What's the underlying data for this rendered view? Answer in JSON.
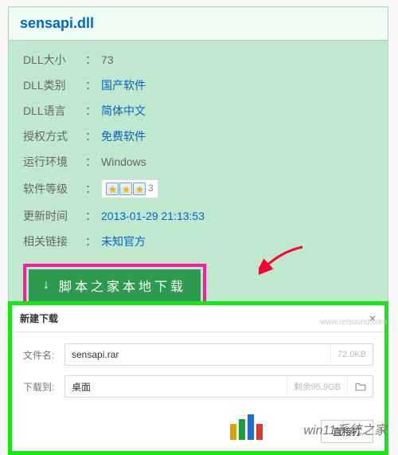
{
  "title": "sensapi.dll",
  "info": {
    "size_label": "DLL大小",
    "size_value": "73",
    "category_label": "DLL类别",
    "category_value": "国产软件",
    "language_label": "DLL语言",
    "language_value": "简体中文",
    "license_label": "授权方式",
    "license_value": "免费软件",
    "env_label": "运行环境",
    "env_value": "Windows",
    "rating_label": "软件等级",
    "rating_stars": 3,
    "updated_label": "更新时间",
    "updated_value": "2013-01-29 21:13:53",
    "related_label": "相关链接",
    "related_value": "未知官方"
  },
  "download_button": "脚本之家本地下载",
  "dialog": {
    "title": "新建下载",
    "filename_label": "文件名:",
    "filename_value": "sensapi.rar",
    "filesize": "72.0KB",
    "saveto_label": "下载到:",
    "saveto_value": "桌面",
    "remaining": "剩余95.9GB",
    "direct_open": "直接打"
  },
  "watermark": {
    "site1": "www.relsound.com",
    "site2": "win11系统之家"
  }
}
